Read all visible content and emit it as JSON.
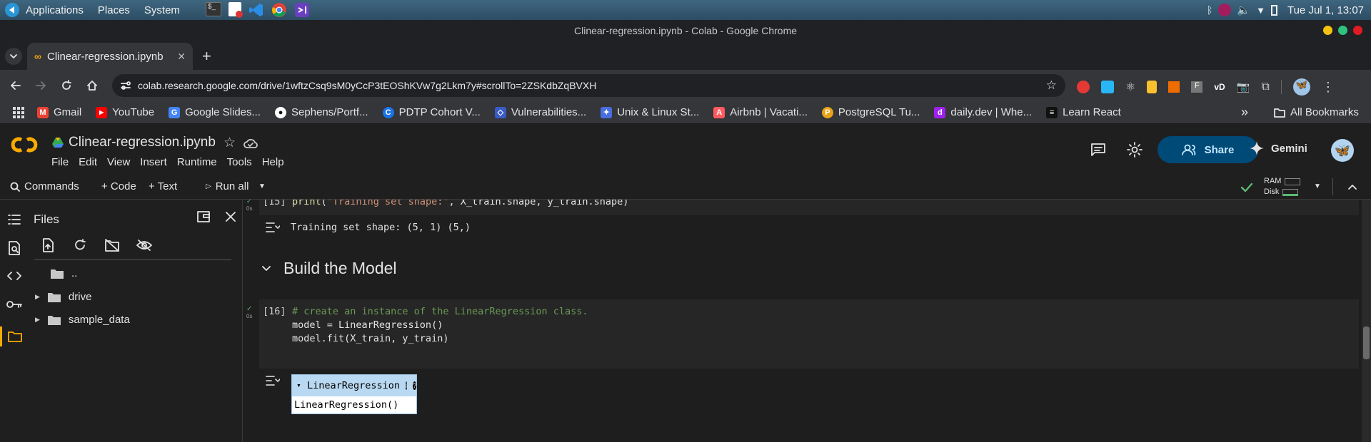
{
  "os": {
    "menus": [
      "Applications",
      "Places",
      "System"
    ],
    "clock": "Tue Jul 1, 13:07"
  },
  "window": {
    "title": "Clinear-regression.ipynb - Colab - Google Chrome"
  },
  "tab": {
    "title": "Clinear-regression.ipynb"
  },
  "address": {
    "url": "colab.research.google.com/drive/1wftzCsq9sM0yCcP3tEOShKVw7g2Lkm7y#scrollTo=2ZSKdbZqBVXH"
  },
  "bookmarks": [
    {
      "label": "Gmail",
      "color": "#ea4335",
      "glyph": "M"
    },
    {
      "label": "YouTube",
      "color": "#ff0000",
      "glyph": "▶"
    },
    {
      "label": "Google Slides...",
      "color": "#4285f4",
      "glyph": "G"
    },
    {
      "label": "Sephens/Portf...",
      "color": "#2b2b2b",
      "glyph": "●"
    },
    {
      "label": "PDTP Cohort V...",
      "color": "#1a73e8",
      "glyph": "C"
    },
    {
      "label": "Vulnerabilities...",
      "color": "#3a5bc7",
      "glyph": "◇"
    },
    {
      "label": "Unix & Linux St...",
      "color": "#4a6ee0",
      "glyph": "✦"
    },
    {
      "label": "Airbnb | Vacati...",
      "color": "#ff5a5f",
      "glyph": "A"
    },
    {
      "label": "PostgreSQL Tu...",
      "color": "#e8a317",
      "glyph": "P"
    },
    {
      "label": "daily.dev | Whe...",
      "color": "#a020f0",
      "glyph": "d"
    },
    {
      "label": "Learn React",
      "color": "#111111",
      "glyph": "≡"
    }
  ],
  "all_bookmarks": "All Bookmarks",
  "colab": {
    "filename": "Clinear-regression.ipynb",
    "menu": [
      "File",
      "Edit",
      "View",
      "Insert",
      "Runtime",
      "Tools",
      "Help"
    ],
    "share": "Share",
    "gemini": "Gemini",
    "toolbar": {
      "commands": "Commands",
      "code": "+ Code",
      "text": "+ Text",
      "run_all": "Run all",
      "ram": "RAM",
      "disk": "Disk"
    }
  },
  "files": {
    "title": "Files",
    "items": [
      {
        "name": "..",
        "type": "parent"
      },
      {
        "name": "drive",
        "type": "folder"
      },
      {
        "name": "sample_data",
        "type": "folder"
      }
    ]
  },
  "notebook": {
    "cell15": {
      "num": "[15]",
      "time": "0s",
      "code": "print(\"Training set shape:\", X_train.shape, y_train.shape)",
      "output": "Training set shape: (5, 1) (5,)"
    },
    "section": "Build the Model",
    "cell16": {
      "num": "[16]",
      "time": "0s",
      "line1": "# create an instance of the LinearRegression class.",
      "line2": "model = LinearRegression()",
      "line3": "model.fit(X_train, y_train)",
      "widget_title": "LinearRegression",
      "widget_body": "LinearRegression()"
    }
  },
  "colors": {
    "accent": "#0b57d0",
    "share_bg": "#004a77",
    "orange": "#f9ab00"
  }
}
